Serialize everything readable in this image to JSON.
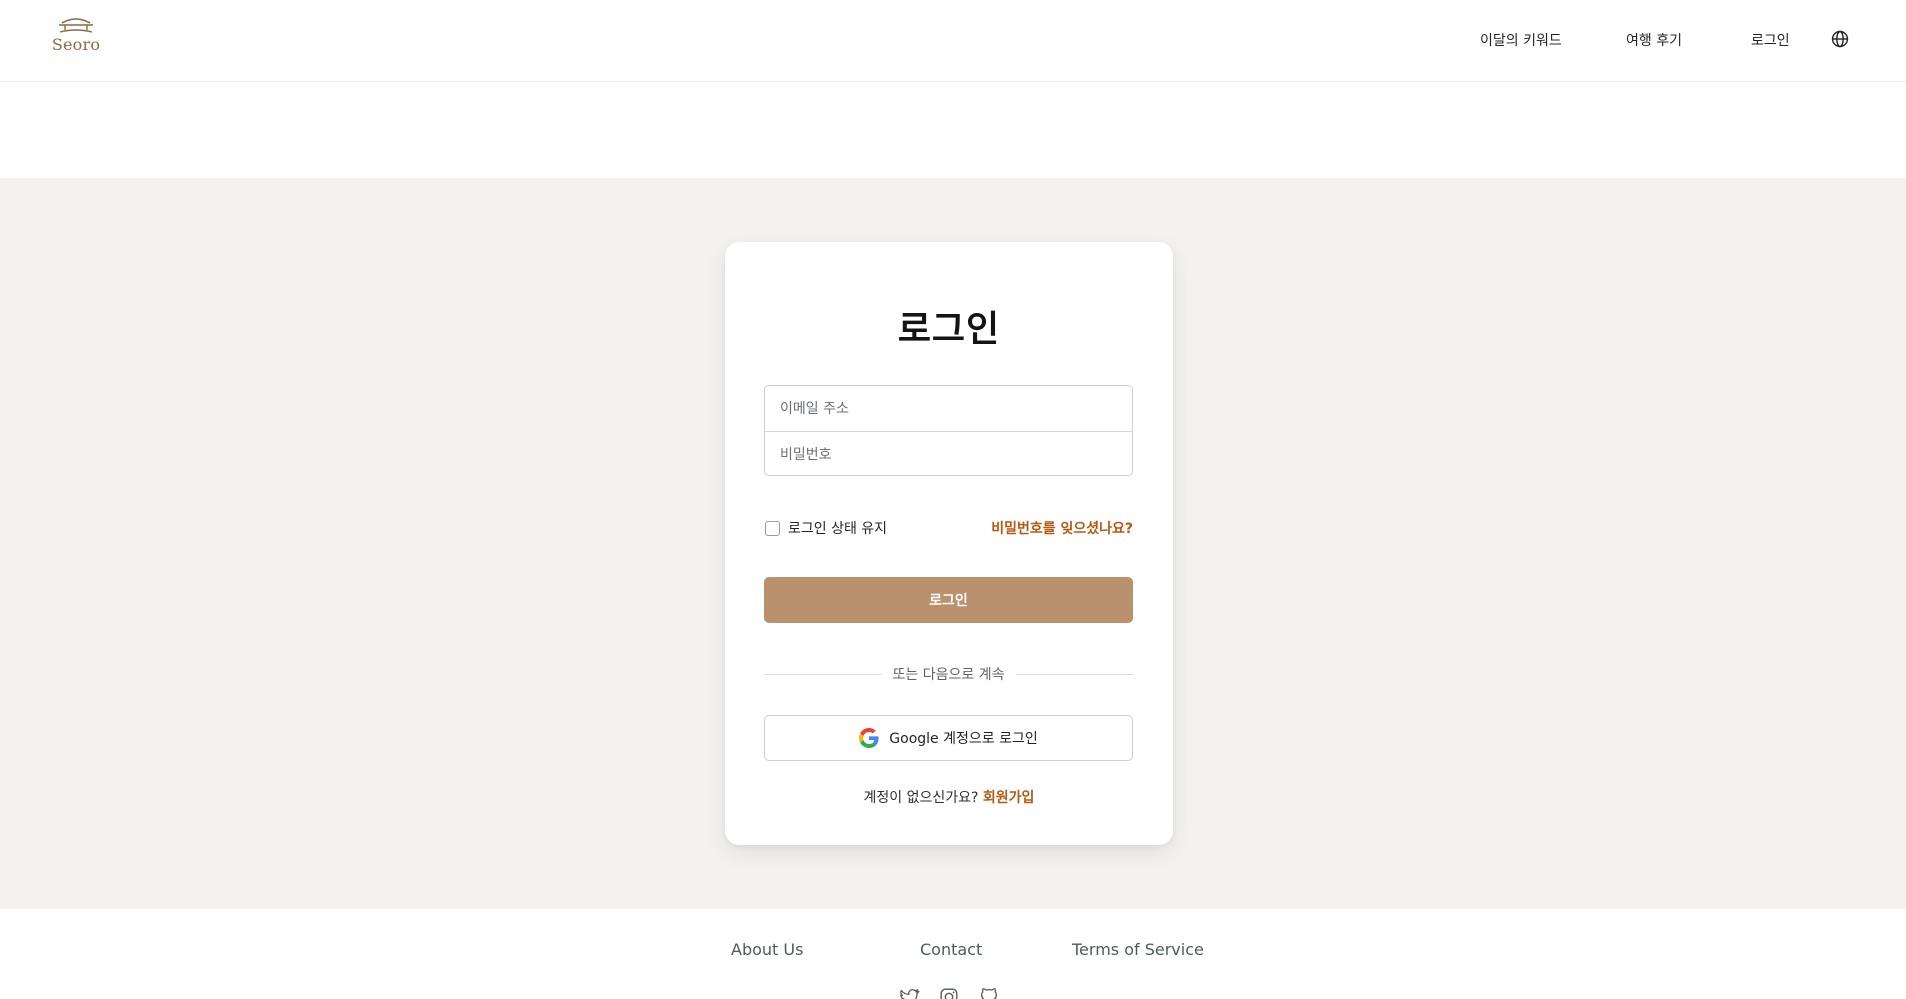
{
  "header": {
    "logo_text": "Seoro",
    "nav": {
      "keyword": "이달의 키워드",
      "review": "여행 후기",
      "login": "로그인"
    },
    "language_icon": "globe-icon"
  },
  "login_card": {
    "title": "로그인",
    "email_placeholder": "이메일 주소",
    "password_placeholder": "비밀번호",
    "remember_label": "로그인 상태 유지",
    "forgot_link": "비밀번호를 잊으셨나요?",
    "login_button": "로그인",
    "divider_text": "또는 다음으로 계속",
    "google_button": "Google 계정으로 로그인",
    "no_account_text": "계정이 없으신가요?",
    "signup_link": "회원가입"
  },
  "footer": {
    "links": {
      "about": "About Us",
      "contact": "Contact",
      "terms": "Terms of Service"
    },
    "social_icons": [
      "twitter-icon",
      "instagram-icon",
      "github-icon"
    ]
  },
  "colors": {
    "brand": "#8b6a45",
    "primary_button": "#b9926d",
    "accent_link": "#b35a12",
    "page_background": "#f3f2f0"
  }
}
